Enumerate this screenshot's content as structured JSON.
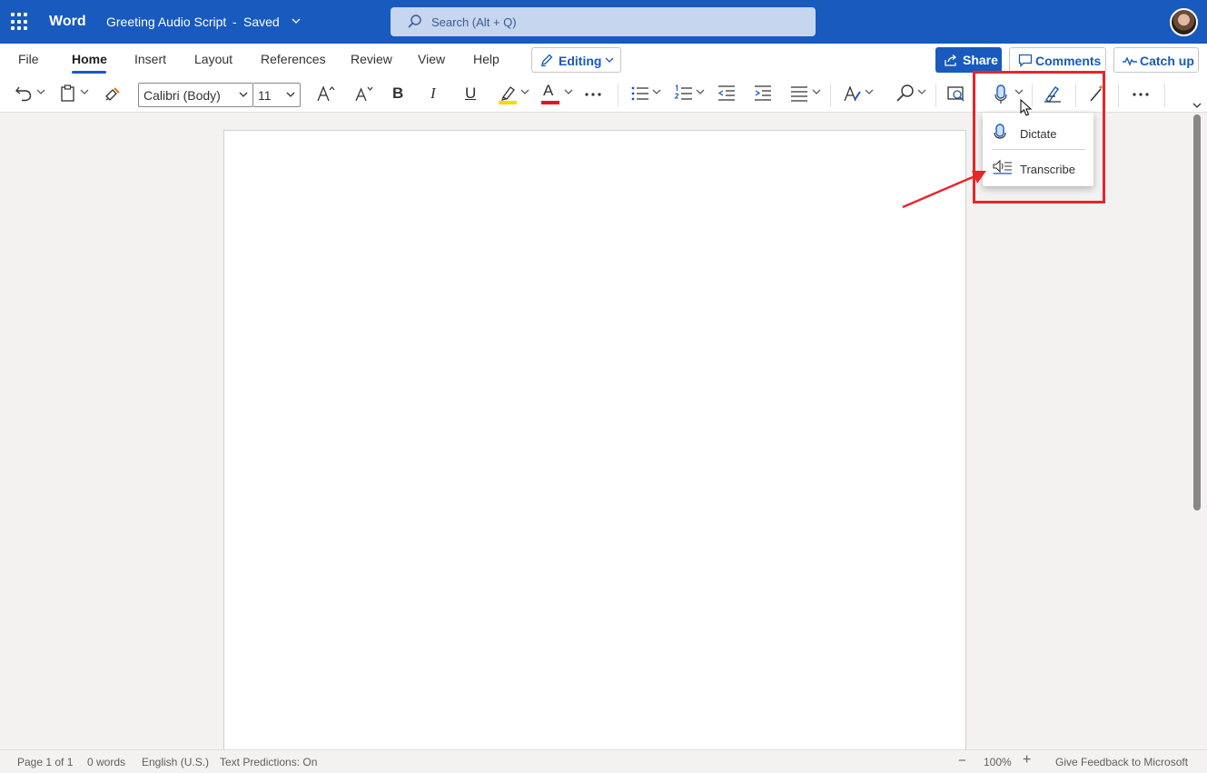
{
  "titlebar": {
    "app_name": "Word",
    "doc_title": "Greeting Audio Script",
    "separator": "-",
    "status": "Saved",
    "search_placeholder": "Search (Alt + Q)"
  },
  "tabs": [
    "File",
    "Home",
    "Insert",
    "Layout",
    "References",
    "Review",
    "View",
    "Help"
  ],
  "active_tab": "Home",
  "mode_button": "Editing",
  "actions": {
    "share": "Share",
    "comments": "Comments",
    "catch_up": "Catch up"
  },
  "toolbar": {
    "font_name": "Calibri (Body)",
    "font_size": "11",
    "bold": "B",
    "italic": "I",
    "underline": "U",
    "font_color_letter": "A",
    "highlight_color": "#ffd800",
    "font_color": "#e81123"
  },
  "dictate_menu": {
    "items": [
      {
        "label": "Dictate",
        "icon": "microphone-icon"
      },
      {
        "label": "Transcribe",
        "icon": "transcribe-icon"
      }
    ]
  },
  "statusbar": {
    "page": "Page 1 of 1",
    "words": "0 words",
    "language": "English (U.S.)",
    "predictions": "Text Predictions: On",
    "zoom_minus": "−",
    "zoom": "100%",
    "zoom_plus": "+",
    "feedback": "Give Feedback to Microsoft"
  },
  "colors": {
    "brand": "#185abd",
    "annotation": "#e8252b"
  }
}
